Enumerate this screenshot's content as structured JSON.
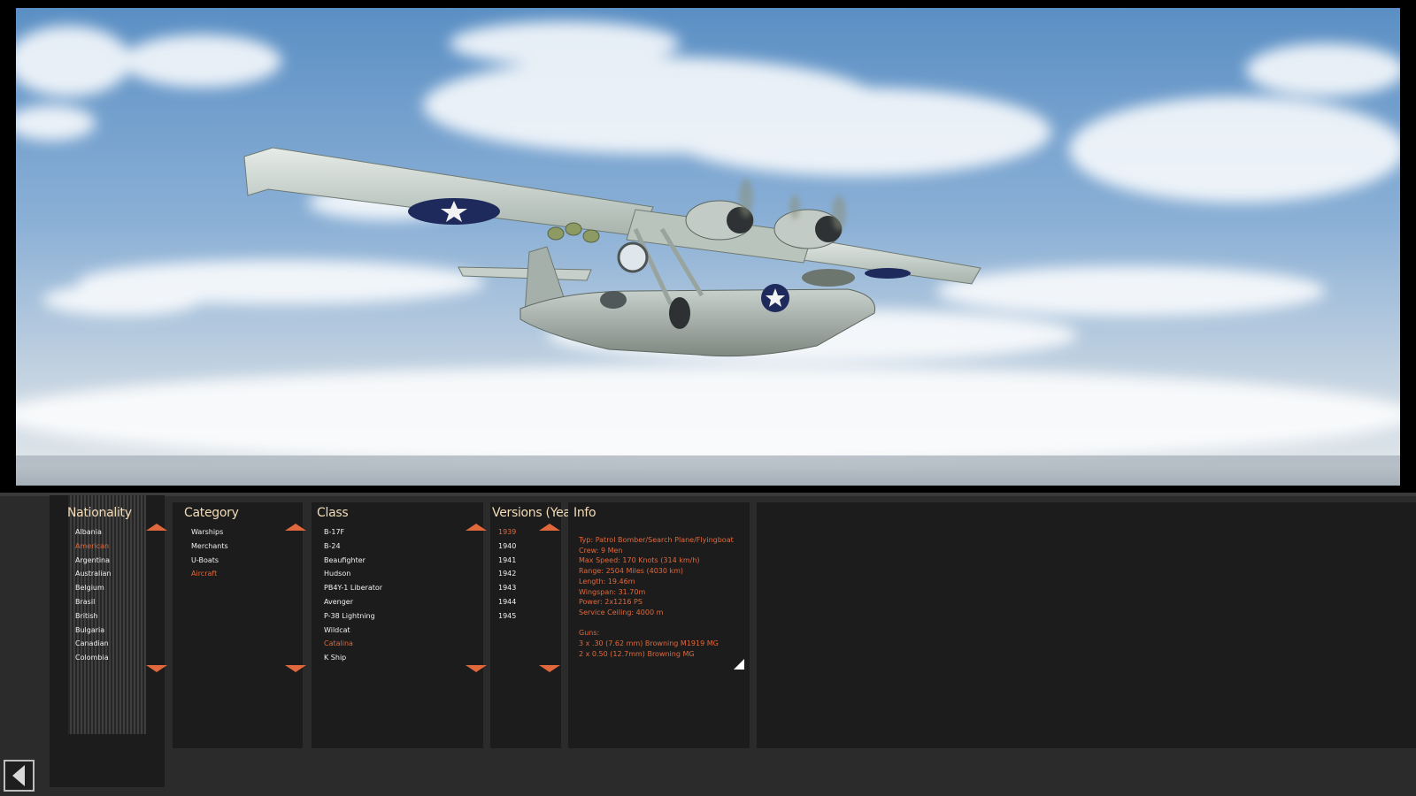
{
  "nationality": {
    "title": "Nationality",
    "items": [
      "Albania",
      "American",
      "Argentina",
      "Australian",
      "Belgium",
      "Brasil",
      "British",
      "Bulgaria",
      "Canadian",
      "Colombia"
    ],
    "selected": "American"
  },
  "category": {
    "title": "Category",
    "items": [
      "Warships",
      "Merchants",
      "U-Boats",
      "Aircraft"
    ],
    "selected": "Aircraft"
  },
  "class": {
    "title": "Class",
    "items": [
      "B-17F",
      "B-24",
      "Beaufighter",
      "Hudson",
      "PB4Y-1 Liberator",
      "Avenger",
      "P-38 Lightning",
      "Wildcat",
      "Catalina",
      "K Ship"
    ],
    "selected": "Catalina"
  },
  "versions": {
    "title": "Versions (Year)",
    "items": [
      "1939",
      "1940",
      "1941",
      "1942",
      "1943",
      "1944",
      "1945"
    ],
    "selected": "1939"
  },
  "info": {
    "title": "Info",
    "lines": [
      "Typ: Patrol Bomber/Search Plane/Flyingboat",
      "Crew: 9 Men",
      "Max Speed: 170 Knots (314 km/h)",
      "Range: 2504 Miles (4030 km)",
      "Length: 19.46m",
      "Wingspan: 31.70m",
      "Power: 2x1216 PS",
      "Service Ceiling: 4000 m",
      "",
      "Guns:",
      "3 x .30 (7.62 mm) Browning M1919 MG",
      "2 x 0.50 (12.7mm) Browning MG"
    ]
  },
  "colors": {
    "accent": "#e0683c",
    "title_text": "#f2dcb7",
    "list_text": "#f0f0f0",
    "panel_bg": "#1c1c1c"
  },
  "icons": {
    "scroll_up": "triangle-up-icon",
    "scroll_down": "triangle-down-icon",
    "back": "chevron-left-icon",
    "resize": "resize-corner-icon"
  }
}
